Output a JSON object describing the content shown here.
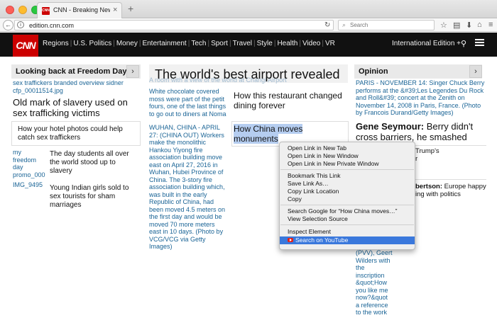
{
  "browser": {
    "tab_title": "CNN - Breaking News, U.S....",
    "tab_favicon": "CNN",
    "tab_close": "×",
    "new_tab": "+",
    "url": "edition.cnn.com",
    "search_placeholder": "Search",
    "icons": [
      "back-icon",
      "info-icon",
      "reload-icon",
      "search-icon",
      "star-icon",
      "reading-list-icon",
      "download-icon",
      "home-icon",
      "menu-icon"
    ]
  },
  "header": {
    "logo": "CNN",
    "nav": [
      "Regions",
      "U.S. Politics",
      "Money",
      "Entertainment",
      "Tech",
      "Sport",
      "Travel",
      "Style",
      "Health",
      "Video",
      "VR"
    ],
    "edition": "International Edition +"
  },
  "left_col": {
    "title": "Looking back at Freedom Day",
    "arrow": "›",
    "img_caption": "sex traffickers branded overview sidner cfp_00011514.jpg",
    "headline": "Old mark of slavery used on sex trafficking victims",
    "story1": "How your hotel photos could help catch sex traffickers",
    "img2": "my freedom day promo_000",
    "story2": "The day students all over the world stood up to slavery",
    "img3": "IMG_9495",
    "story3": "Young Indian girls sold to sex tourists for sham marriages"
  },
  "center_col": {
    "hero_title": "The world's best airport revealed",
    "hero_overlay": "A room with a view of the world at Changi Airport",
    "caption1": "White chocolate covered moss were part of the petit fours, one of the last things to go out to diners at Noma",
    "caption2": "WUHAN, CHINA - APRIL 27: (CHINA OUT) Workers make the monolithic Hankou Yiyong fire association building move east on April 27, 2016 in Wuhan, Hubei Province of China. The 3-story fire association building which, was built in the early Republic of China, had been moved 4.5 meters on the first day and would be moved 70 more meters east in 10 days. (Photo by VCG/VCG via Getty Images)",
    "story1": "How this restaurant changed dining forever",
    "story2_selected": "How China moves monuments"
  },
  "right_col": {
    "title": "Opinion",
    "arrow": "›",
    "caption": "PARIS - NOVEMBER 14: Singer Chuck Berry performs at the &#39;Les Legendes Du Rock and Roll&#39; concert at the Zenith on November 14, 2008 in Paris, France. (Photo by Francois Durand/Getty Images)",
    "headline_bold": "Gene Seymour:",
    "headline_rest": "Berry didn't cross barriers, he smashed them",
    "partial1": "Trump's",
    "partial1b": "r",
    "partial2_bold": "bertson:",
    "partial2_rest": "Europe happy",
    "partial2b": "ing with politics",
    "wilders": "(PVV), Geert Wilders with the inscription &quot;How you like me now?&quot a reference to the work"
  },
  "context_menu": {
    "items": [
      "Open Link in New Tab",
      "Open Link in New Window",
      "Open Link in New Private Window",
      "Bookmark This Link",
      "Save Link As…",
      "Copy Link Location",
      "Copy",
      "Search Google for “How China moves…”",
      "View Selection Source",
      "Inspect Element",
      "Search on YouTube"
    ],
    "highlighted_index": 10,
    "highlight_color": "#3a78dc"
  },
  "colors": {
    "cnn_red": "#cc0000",
    "link_blue": "#1a6496",
    "selection": "#b5cdf0"
  }
}
